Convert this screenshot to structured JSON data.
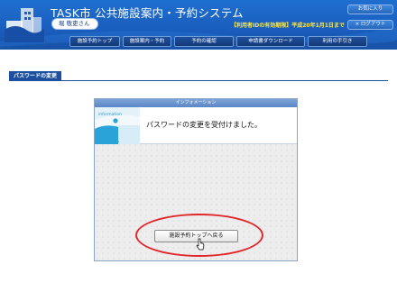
{
  "header": {
    "app_title": "TASK市 公共施設案内・予約システム",
    "user_name": "堀 敬吏さん",
    "expiry_notice": "【利用者IDの有効期限】平成20年1月1日まで",
    "favorite_label": "お気に入り",
    "logout_label": "ログアウト",
    "logout_marker": "×"
  },
  "nav": {
    "items": [
      {
        "label": "施設予約トップ"
      },
      {
        "label": "施設案内・予約"
      },
      {
        "label": "予約の確認"
      },
      {
        "label": "申請書ダウンロード"
      },
      {
        "label": "利用の手引き"
      }
    ]
  },
  "page": {
    "title": "パスワードの変更"
  },
  "panel": {
    "heading": "インフォメーション",
    "icon_text": "information",
    "icon_letter": "i",
    "message": "パスワードの変更を受付けました。",
    "back_button_label": "施設予約トップへ戻る"
  },
  "colors": {
    "header_blue": "#1a5fbf",
    "nav_dark": "#143a78",
    "title_bar": "#1c4f9d",
    "expiry_yellow": "#ffe94a",
    "highlight_red": "#e0282c",
    "panel_accent": "#2aa4d8"
  }
}
